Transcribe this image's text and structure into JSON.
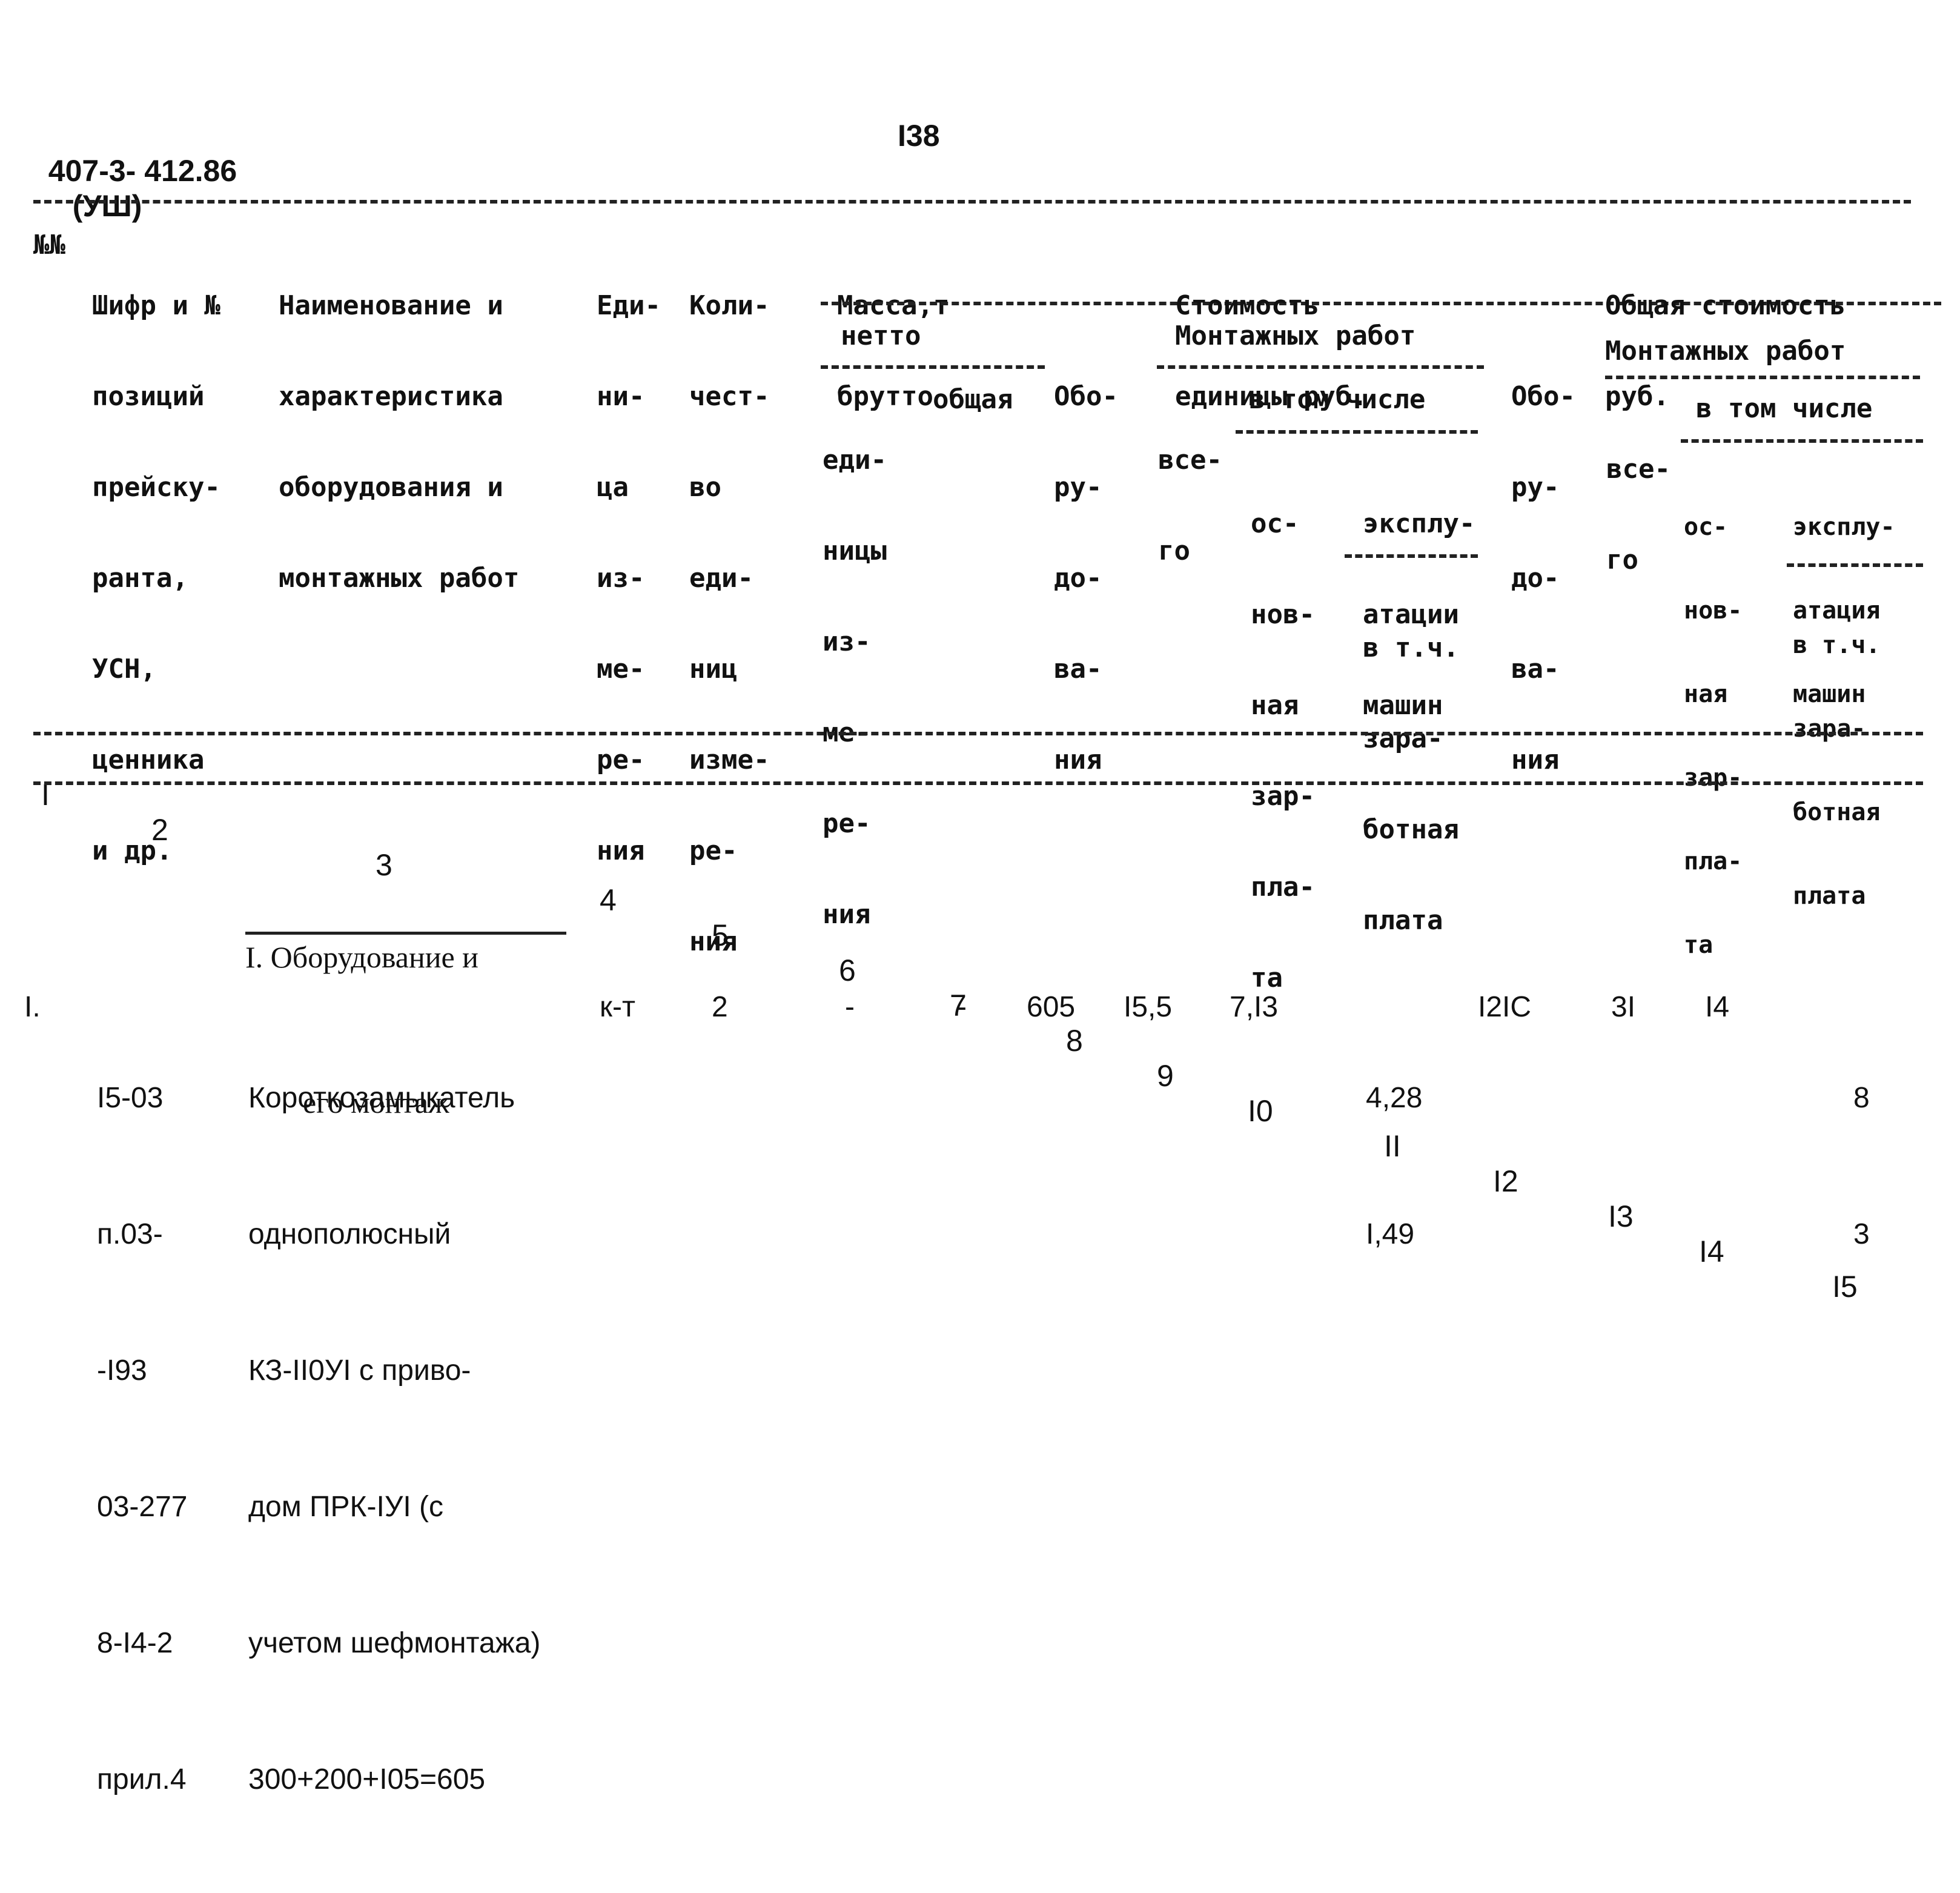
{
  "page": {
    "doc_code": "407-3- 412.86",
    "doc_volume": "(УШ)",
    "page_number": "I38"
  },
  "header": {
    "col1": "№№",
    "col2": [
      "Шифр и №",
      "позиций",
      "прейску-",
      "ранта,",
      "УСН,",
      "ценника",
      "и др."
    ],
    "col3": [
      "Наименование и",
      "характеристика",
      "оборудования и",
      "монтажных работ"
    ],
    "col4": [
      "Еди-",
      "ни-",
      "ца",
      "из-",
      "ме-",
      "ре-",
      "ния"
    ],
    "col5": [
      "Коли-",
      "чест-",
      "во",
      "еди-",
      "ниц",
      "изме-",
      "ре-",
      "ния"
    ],
    "mass": {
      "title": [
        "Масса,т",
        "брутто"
      ],
      "netto": "нетто",
      "unit": [
        "еди-",
        "ницы",
        "из-",
        "ме-",
        "ре-",
        "ния"
      ],
      "total": "общая"
    },
    "unit_cost": {
      "title": [
        "Стоимость",
        "единицы руб."
      ],
      "equipment": [
        "Обо-",
        "ру-",
        "до-",
        "ва-",
        "ния"
      ],
      "install": "Монтажных работ",
      "all": [
        "все-",
        "го"
      ],
      "incl": "в том числе",
      "base_wage": [
        "ос-",
        "нов-",
        "ная",
        "зар-",
        "пла-",
        "та"
      ],
      "machines": [
        "эксплу-",
        "атации",
        "машин"
      ],
      "machines_wage": [
        "в т.ч.",
        "зара-",
        "ботная",
        "плата"
      ],
      "equipment2": [
        "Обо-",
        "ру-",
        "до-",
        "ва-",
        "ния"
      ]
    },
    "total_cost": {
      "title": [
        "Общая стоимость",
        "руб."
      ],
      "install": "Монтажных работ",
      "all": [
        "все-",
        "го"
      ],
      "incl": "в том числе",
      "base_wage": [
        "ос-",
        "нов-",
        "ная",
        "зар-",
        "пла-",
        "та"
      ],
      "machines": [
        "эксплу-",
        "атация",
        "машин"
      ],
      "machines_wage": [
        "в т.ч.",
        "зара-",
        "ботная",
        "плата"
      ]
    }
  },
  "column_numbers": [
    "I",
    "2",
    "3",
    "4",
    "5",
    "6",
    "7",
    "8",
    "9",
    "I0",
    "II",
    "I2",
    "I3",
    "I4",
    "I5"
  ],
  "section": {
    "title_line1": "I. Оборудование и",
    "title_line2": "его монтаж"
  },
  "rows": [
    {
      "num": "I.",
      "code": [
        "I5-03",
        "п.03-",
        "-I93",
        "03-277",
        "8-I4-2",
        "прил.4"
      ],
      "name": [
        "Короткозамыкатель",
        "однополюсный",
        "КЗ-II0УI с приво-",
        "дом ПРК-IУI (с",
        "учетом шефмонтажа)",
        "300+200+I05=605"
      ],
      "unit": "к-т",
      "qty": "2",
      "mass_unit": "-",
      "mass_total": "-",
      "equip_cost": "605",
      "install_all": "I5,5",
      "base_wage": "7,I3",
      "machines": "4,28",
      "machines_wage": "I,49",
      "equip_total": "I2IC",
      "install_total": "3I",
      "base_wage_total": "I4",
      "machines_total": "8",
      "machines_wage_total": "3"
    }
  ]
}
